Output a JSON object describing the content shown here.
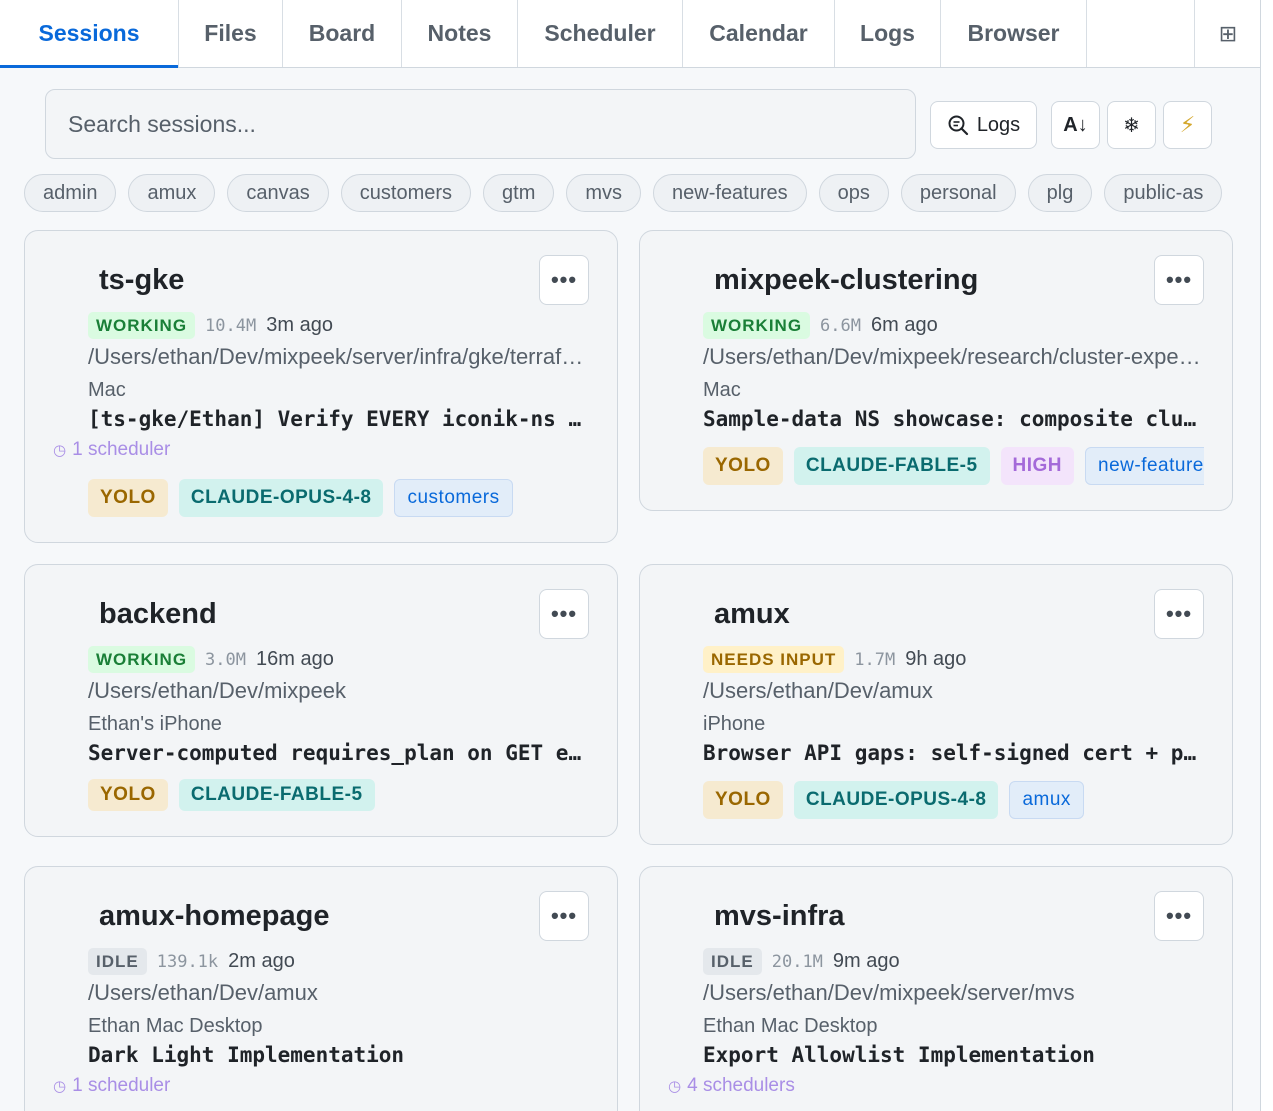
{
  "tabs": [
    {
      "label": "Sessions",
      "active": true
    },
    {
      "label": "Files"
    },
    {
      "label": "Board"
    },
    {
      "label": "Notes"
    },
    {
      "label": "Scheduler"
    },
    {
      "label": "Calendar"
    },
    {
      "label": "Logs"
    },
    {
      "label": "Browser"
    }
  ],
  "toolbar": {
    "search_placeholder": "Search sessions...",
    "logs_label": "Logs",
    "sort_label": "A↓",
    "freeze_icon": "snowflake-icon",
    "bolt_icon": "lightning-icon",
    "layout_icon": "grid-icon"
  },
  "tag_filters": [
    "admin",
    "amux",
    "canvas",
    "customers",
    "gtm",
    "mvs",
    "new-features",
    "ops",
    "personal",
    "plg",
    "public-as"
  ],
  "sessions": [
    {
      "title": "ts-gke",
      "status": "WORKING",
      "tokens": "10.4M",
      "ago": "3m ago",
      "path": "/Users/ethan/Dev/mixpeek/server/infra/gke/terraform",
      "device": "Mac",
      "task": "[ts-gke/Ethan] Verify EVERY iconik-ns deployment",
      "scheduler": "1 scheduler",
      "badges": [
        "YOLO",
        "CLAUDE-OPUS-4-8",
        "customers"
      ]
    },
    {
      "title": "mixpeek-clustering",
      "status": "WORKING",
      "tokens": "6.6M",
      "ago": "6m ago",
      "path": "/Users/ethan/Dev/mixpeek/research/cluster-experiments",
      "device": "Mac",
      "task": "Sample-data NS showcase: composite clustering",
      "badges": [
        "YOLO",
        "CLAUDE-FABLE-5",
        "HIGH",
        "new-features"
      ]
    },
    {
      "title": "backend",
      "status": "WORKING",
      "tokens": "3.0M",
      "ago": "16m ago",
      "path": "/Users/ethan/Dev/mixpeek",
      "device": "Ethan's iPhone",
      "task": "Server-computed requires_plan on GET endpoints",
      "badges": [
        "YOLO",
        "CLAUDE-FABLE-5"
      ]
    },
    {
      "title": "amux",
      "status": "NEEDS INPUT",
      "tokens": "1.7M",
      "ago": "9h ago",
      "path": "/Users/ethan/Dev/amux",
      "device": "iPhone",
      "task": "Browser API gaps: self-signed cert + proxy",
      "badges": [
        "YOLO",
        "CLAUDE-OPUS-4-8",
        "amux"
      ]
    },
    {
      "title": "amux-homepage",
      "status": "IDLE",
      "tokens": "139.1k",
      "ago": "2m ago",
      "path": "/Users/ethan/Dev/amux",
      "device": "Ethan Mac Desktop",
      "task": "Dark Light Implementation",
      "scheduler": "1 scheduler"
    },
    {
      "title": "mvs-infra",
      "status": "IDLE",
      "tokens": "20.1M",
      "ago": "9m ago",
      "path": "/Users/ethan/Dev/mixpeek/server/mvs",
      "device": "Ethan Mac Desktop",
      "task": "Export Allowlist Implementation",
      "scheduler": "4 schedulers"
    }
  ],
  "colors": {
    "accent": "#0969da",
    "working": "#1a7f37",
    "needs_input": "#9a6700",
    "idle": "#57606a",
    "scheduler": "#a98ee6"
  }
}
